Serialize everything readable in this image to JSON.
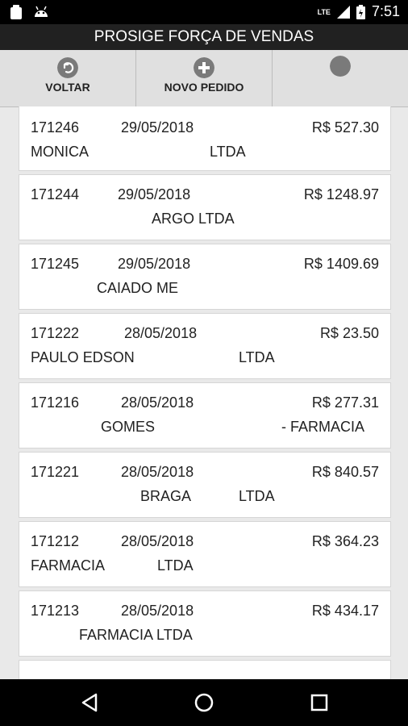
{
  "status": {
    "network": "LTE",
    "time": "7:51"
  },
  "app": {
    "title": "PROSIGE FORÇA DE VENDAS"
  },
  "toolbar": {
    "back_label": "VOLTAR",
    "new_order_label": "NOVO PEDIDO",
    "third_label": ""
  },
  "orders": [
    {
      "number": "171246",
      "date": "29/05/2018",
      "total": "R$ 527.30",
      "client_a": "MONICA",
      "client_b": "LTDA"
    },
    {
      "number": "171244",
      "date": "29/05/2018",
      "total": "R$ 1248.97",
      "client_a": "ARGO LTDA",
      "client_b": ""
    },
    {
      "number": "171245",
      "date": "29/05/2018",
      "total": "R$ 1409.69",
      "client_a": "CAIADO ME",
      "client_b": ""
    },
    {
      "number": "171222",
      "date": "28/05/2018",
      "total": "R$ 23.50",
      "client_a": "PAULO EDSON",
      "client_b": "LTDA"
    },
    {
      "number": "171216",
      "date": "28/05/2018",
      "total": "R$ 277.31",
      "client_a": "GOMES",
      "client_b": "- FARMACIA"
    },
    {
      "number": "171221",
      "date": "28/05/2018",
      "total": "R$ 840.57",
      "client_a": "BRAGA",
      "client_b": "LTDA"
    },
    {
      "number": "171212",
      "date": "28/05/2018",
      "total": "R$ 364.23",
      "client_a": "FARMACIA",
      "client_b": "LTDA"
    },
    {
      "number": "171213",
      "date": "28/05/2018",
      "total": "R$ 434.17",
      "client_a": "FARMACIA LTDA",
      "client_b": ""
    }
  ]
}
